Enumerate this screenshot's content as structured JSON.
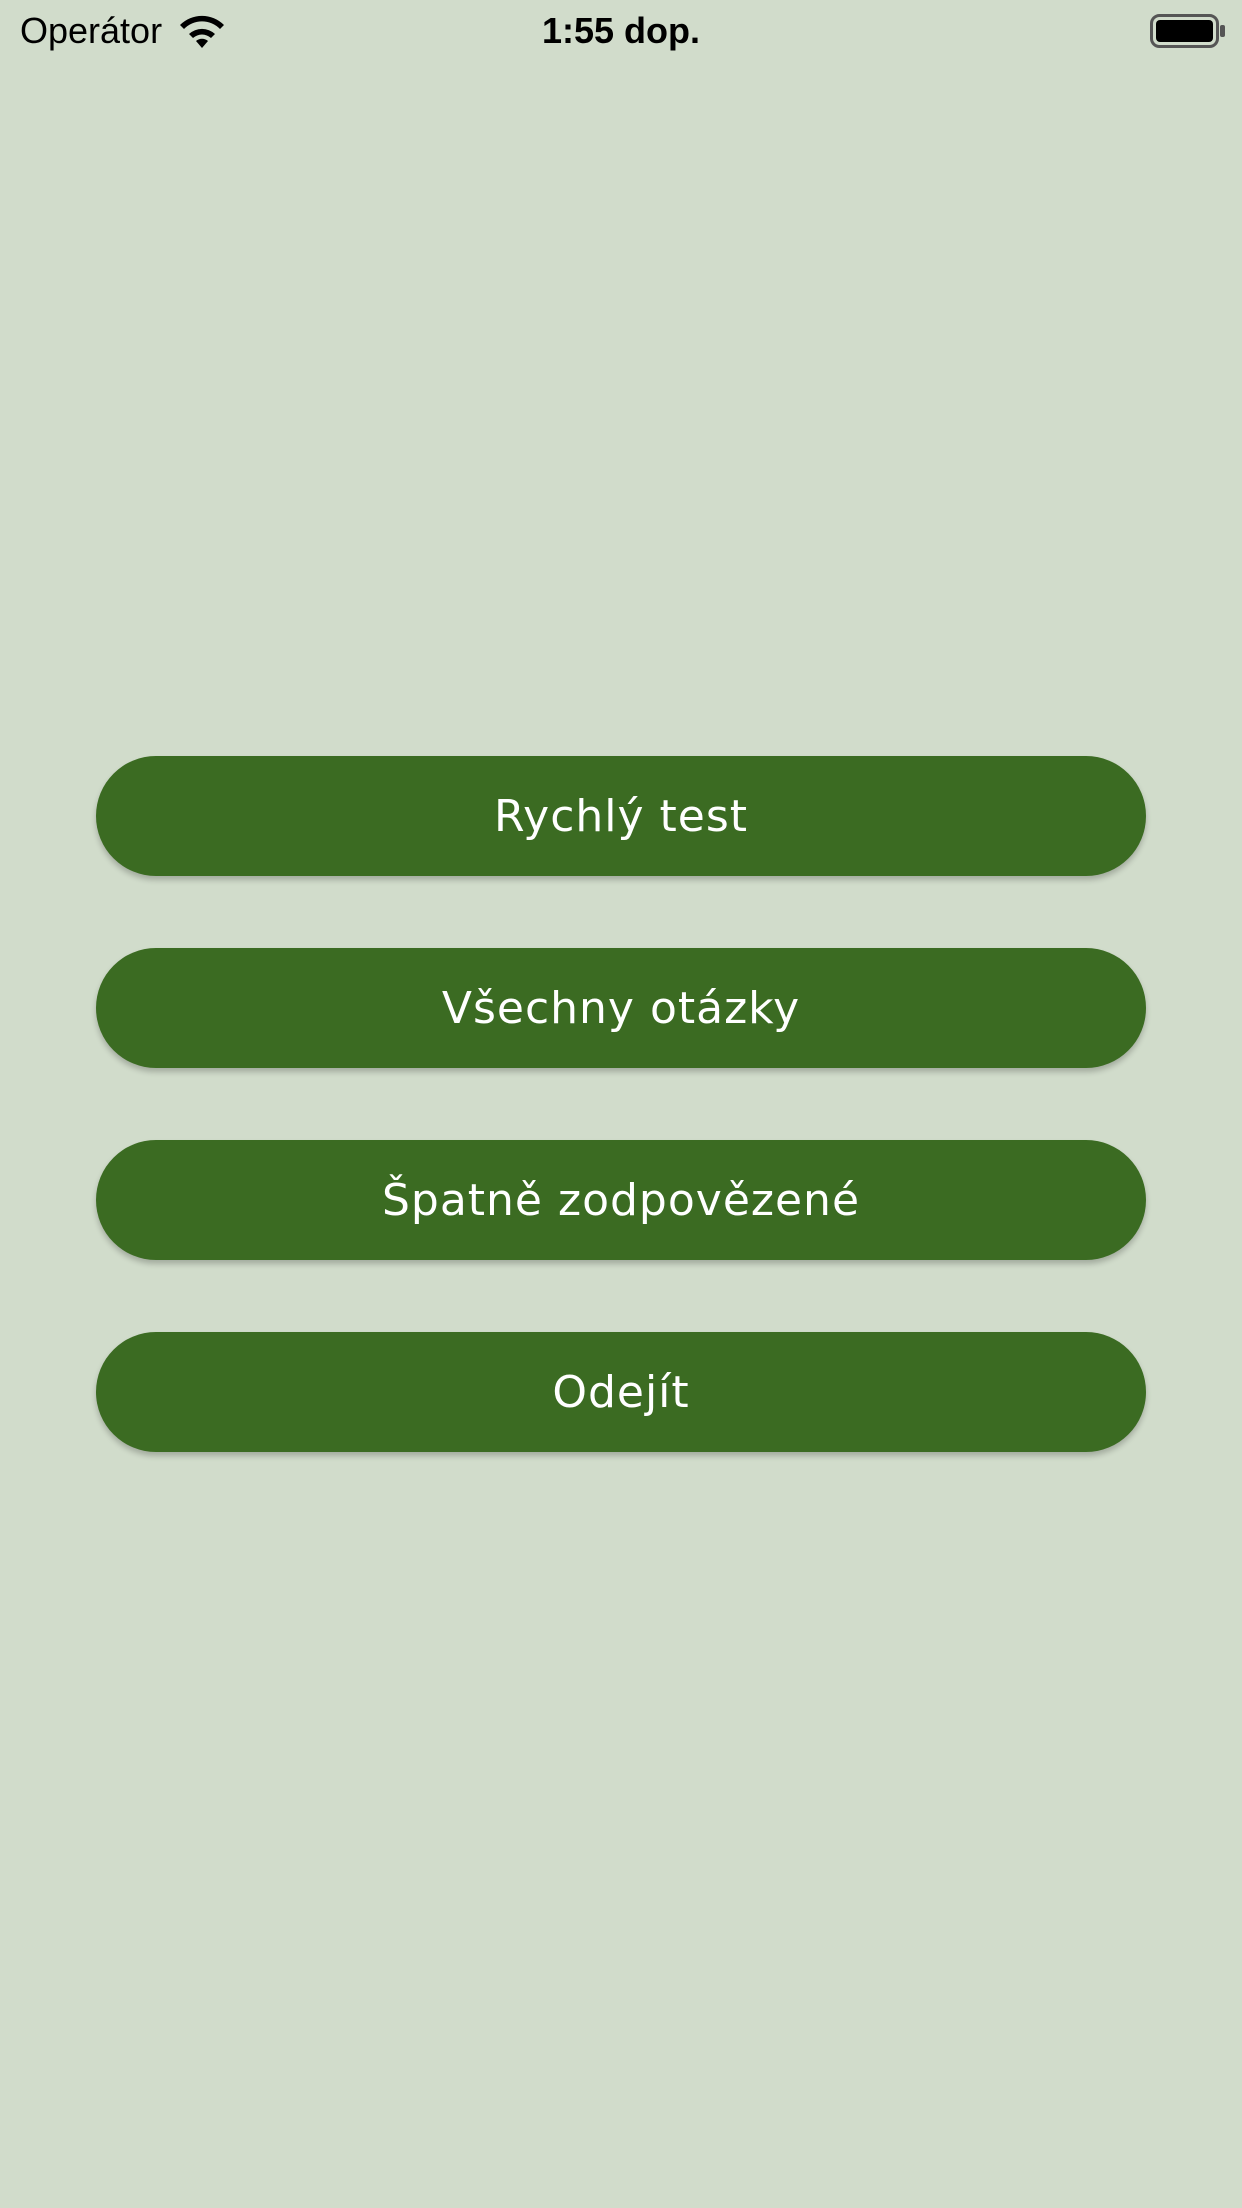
{
  "status_bar": {
    "carrier": "Operátor",
    "time": "1:55 dop.",
    "icons": [
      "wifi-icon",
      "battery-icon"
    ]
  },
  "menu": {
    "buttons": [
      {
        "label": "Rychlý test"
      },
      {
        "label": "Všechny otázky"
      },
      {
        "label": "Špatně zodpovězené"
      },
      {
        "label": "Odejít"
      }
    ]
  },
  "colors": {
    "background": "#d1dccb",
    "button": "#3b6b22",
    "button_text": "#ffffff"
  }
}
